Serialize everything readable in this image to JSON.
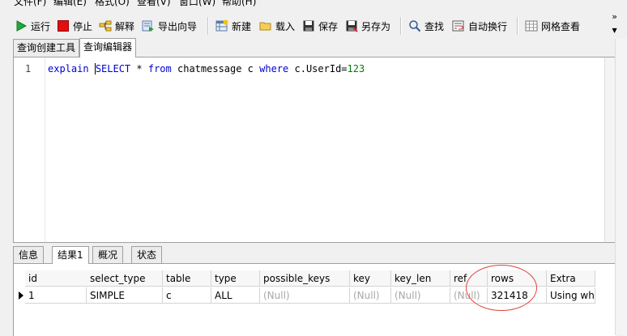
{
  "menu": {
    "items": [
      "文件(F)",
      "编辑(E)",
      "格式(O)",
      "查看(V)",
      "窗口(W)",
      "帮助(H)"
    ]
  },
  "toolbar": {
    "run": {
      "label": "运行",
      "icon": "play-icon"
    },
    "stop": {
      "label": "停止",
      "icon": "stop-icon"
    },
    "explain": {
      "label": "解释",
      "icon": "explain-icon"
    },
    "export_wizard": {
      "label": "导出向导",
      "icon": "export-icon"
    },
    "new": {
      "label": "新建",
      "icon": "new-icon"
    },
    "load": {
      "label": "载入",
      "icon": "folder-icon"
    },
    "save": {
      "label": "保存",
      "icon": "save-icon"
    },
    "save_as": {
      "label": "另存为",
      "icon": "save-as-icon"
    },
    "find": {
      "label": "查找",
      "icon": "search-icon"
    },
    "word_wrap": {
      "label": "自动换行",
      "icon": "wrap-icon"
    },
    "grid_view": {
      "label": "网格查看",
      "icon": "grid-icon"
    },
    "more": "»"
  },
  "top_tabs": [
    {
      "label": "查询创建工具",
      "active": false
    },
    {
      "label": "查询编辑器",
      "active": true
    }
  ],
  "editor": {
    "line_number": "1",
    "tokens": {
      "explain": "explain",
      "select": "SELECT",
      "star": " * ",
      "from": "from",
      "table": " chatmessage c ",
      "where": "where",
      "cond": " c.UserId=",
      "value": "123"
    }
  },
  "bottom_tabs": [
    {
      "label": "信息",
      "active": false
    },
    {
      "label": "结果1",
      "active": true
    },
    {
      "label": "概况",
      "active": false
    },
    {
      "label": "状态",
      "active": false
    }
  ],
  "results": {
    "columns": [
      "id",
      "select_type",
      "table",
      "type",
      "possible_keys",
      "key",
      "key_len",
      "ref",
      "rows",
      "Extra"
    ],
    "row": [
      "1",
      "SIMPLE",
      "c",
      "ALL",
      "(Null)",
      "(Null)",
      "(Null)",
      "(Null)",
      "321418",
      "Using whe"
    ]
  },
  "colors": {
    "keyword": "#0000d0",
    "number": "#008000",
    "null_text": "#a8a8a8",
    "annotation_circle": "#e0423a"
  }
}
